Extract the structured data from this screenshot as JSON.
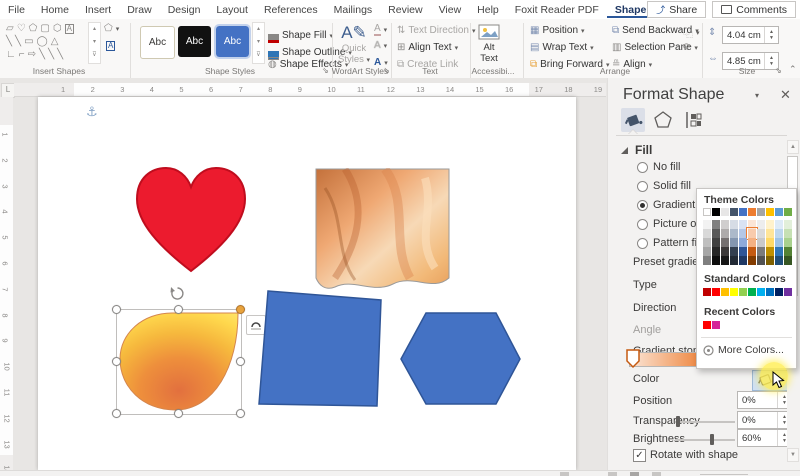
{
  "titlebar": {
    "tabs": [
      "File",
      "Home",
      "Insert",
      "Draw",
      "Design",
      "Layout",
      "References",
      "Mailings",
      "Review",
      "View",
      "Help",
      "Foxit Reader PDF",
      "Shape Format"
    ],
    "active_tab": "Shape Format",
    "share": "Share",
    "comments": "Comments"
  },
  "ribbon": {
    "insert_shapes": {
      "label": "Insert Shapes",
      "gallery": [
        [
          "▱",
          "♡",
          "⬠",
          "▢",
          "⬡",
          "A"
        ],
        [
          "╲",
          "╲",
          "▭",
          "◯",
          "△"
        ],
        [
          "∟",
          "⌐",
          "⇨",
          "╲",
          "╲",
          "╲"
        ]
      ]
    },
    "shape_styles": {
      "label": "Shape Styles",
      "thumb_text": "Abc",
      "fill": "Shape Fill",
      "outline": "Shape Outline",
      "effects": "Shape Effects"
    },
    "wordart": {
      "label": "WordArt Styles",
      "quick_line1": "Quick",
      "quick_line2": "Styles"
    },
    "text_group": {
      "label": "Text",
      "items": [
        "Text Direction",
        "Align Text",
        "Create Link"
      ]
    },
    "accessibility": {
      "label": "Accessibi...",
      "alt_line1": "Alt",
      "alt_line2": "Text"
    },
    "arrange": {
      "label": "Arrange",
      "col1": [
        "Position",
        "Wrap Text",
        "Bring Forward"
      ],
      "col2": [
        "Send Backward",
        "Selection Pane",
        "Align"
      ]
    },
    "size": {
      "label": "Size",
      "height": "4.04 cm",
      "width": "4.85 cm"
    }
  },
  "panel": {
    "title": "Format Shape",
    "section": "Fill",
    "fill_options": [
      "No fill",
      "Solid fill",
      "Gradient fill",
      "Picture or te",
      "Pattern fill"
    ],
    "selected_option": "Gradient fill",
    "labels": {
      "preset": "Preset gradien",
      "type": "Type",
      "direction": "Direction",
      "angle": "Angle",
      "stops": "Gradient stop",
      "color": "Color",
      "position": "Position",
      "transparency": "Transparency",
      "brightness": "Brightness",
      "rotate": "Rotate with shape"
    },
    "values": {
      "position": "0%",
      "transparency": "0%",
      "brightness": "60%",
      "brightness_pct": 60,
      "rotate_checked": true
    }
  },
  "color_popup": {
    "theme_header": "Theme Colors",
    "standard_header": "Standard Colors",
    "recent_header": "Recent Colors",
    "more": "More Colors...",
    "theme_row": [
      "#FFFFFF",
      "#000000",
      "#E7E6E6",
      "#44546A",
      "#4472C4",
      "#ED7D31",
      "#A5A5A5",
      "#FFC000",
      "#5B9BD5",
      "#70AD47"
    ],
    "variants": [
      [
        "#F2F2F2",
        "#808080",
        "#D0CECE",
        "#D6DCE5",
        "#D9E2F3",
        "#FBE5D6",
        "#EDEDED",
        "#FFF2CC",
        "#DEEBF7",
        "#E2EFDA"
      ],
      [
        "#D9D9D9",
        "#595959",
        "#AEABAB",
        "#ACB9CA",
        "#B4C7E7",
        "#F8CBAD",
        "#DBDBDB",
        "#FFE599",
        "#BDD7EE",
        "#C6E0B4"
      ],
      [
        "#BFBFBF",
        "#404040",
        "#757070",
        "#8496B0",
        "#8EAADB",
        "#F4B183",
        "#C9C9C9",
        "#FFD966",
        "#9DC3E6",
        "#A9D18E"
      ],
      [
        "#A6A6A6",
        "#262626",
        "#3B3838",
        "#333F50",
        "#2F5597",
        "#C55A11",
        "#7B7B7B",
        "#BF9000",
        "#2E75B6",
        "#548235"
      ],
      [
        "#7F7F7F",
        "#0D0D0D",
        "#161616",
        "#222A35",
        "#1F3864",
        "#833C00",
        "#525252",
        "#7F6000",
        "#1F4E79",
        "#375623"
      ]
    ],
    "selected_cell": {
      "row": 1,
      "col": 5
    },
    "standard_row": [
      "#C00000",
      "#FF0000",
      "#FFC000",
      "#FFFF00",
      "#92D050",
      "#00B050",
      "#00B0F0",
      "#0070C0",
      "#002060",
      "#7030A0"
    ],
    "recent_row": [
      "#FF0000",
      "#D62598"
    ]
  },
  "canvas": {
    "h_ruler": [
      "1",
      "2",
      "3",
      "4",
      "5",
      "6",
      "7",
      "8",
      "9",
      "10",
      "11",
      "12",
      "13",
      "14",
      "15",
      "16",
      "17",
      "18",
      "19"
    ],
    "v_ruler": [
      "1",
      "2",
      "3",
      "4",
      "5",
      "6",
      "7",
      "8",
      "9",
      "10",
      "11",
      "12",
      "13",
      "14"
    ],
    "shapes": {
      "heart_fill": "#EC1B2E",
      "heart_stroke": "#C00D1E",
      "blue_fill": "#4472C4",
      "blue_stroke": "#2F5597",
      "gradient_stops": [
        "#FFE569",
        "#FFD84D",
        "#F6B83D",
        "#EE8F3C",
        "#E2703E"
      ]
    }
  }
}
